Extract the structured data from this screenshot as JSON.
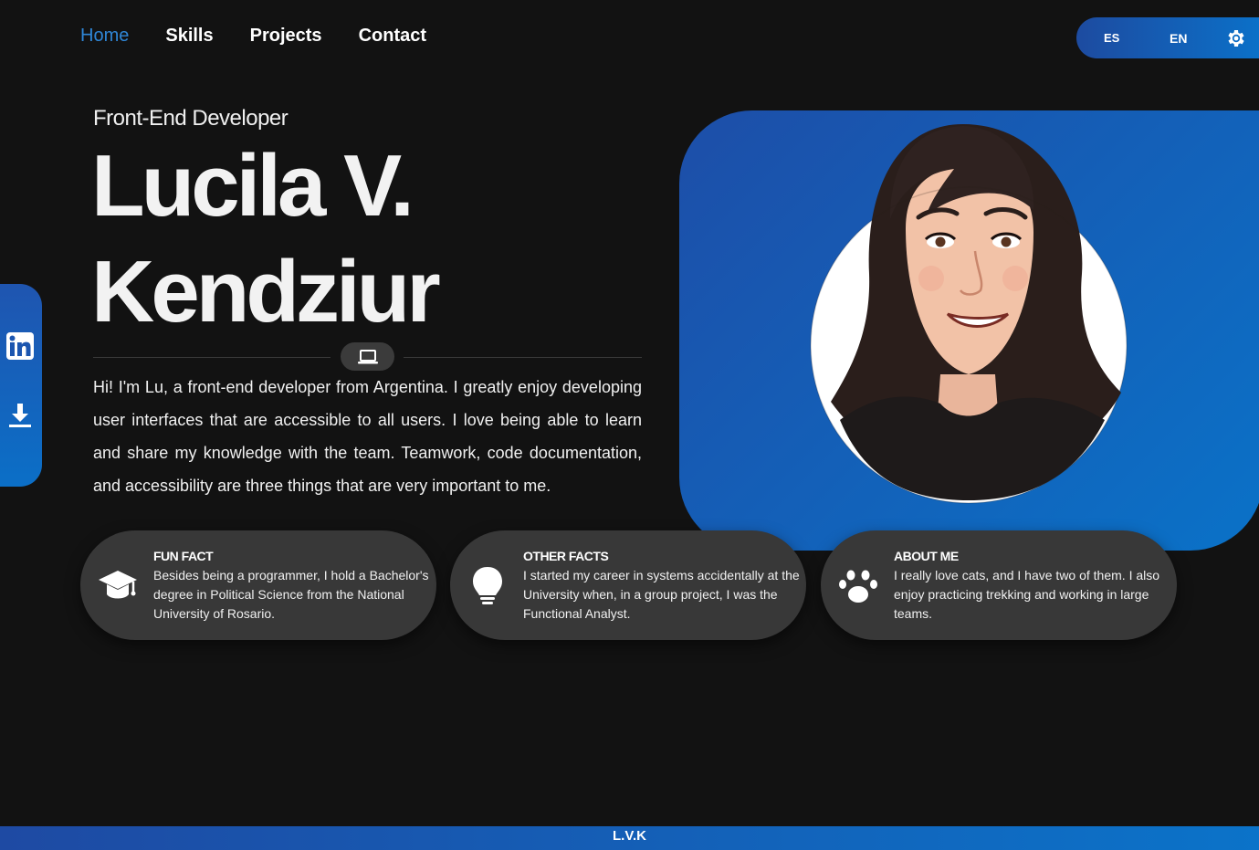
{
  "nav": {
    "items": [
      {
        "label": "Home",
        "active": true
      },
      {
        "label": "Skills",
        "active": false
      },
      {
        "label": "Projects",
        "active": false
      },
      {
        "label": "Contact",
        "active": false
      }
    ]
  },
  "lang": {
    "es": "ES",
    "en": "EN",
    "theme_icon": "gear-icon"
  },
  "side": {
    "icons": [
      "linkedin-icon",
      "download-icon"
    ]
  },
  "hero": {
    "subtitle": "Front-End Developer",
    "name_line1": "Lucila V.",
    "name_line2": "Kendziur",
    "divider_icon": "laptop-icon",
    "bio": "Hi! I'm Lu, a front-end developer from Argentina. I greatly enjoy developing user interfaces that are accessible to all users. I love being able to learn and share my knowledge with the team. Teamwork, code documentation, and accessibility are three things that are very important to me."
  },
  "cards": [
    {
      "icon": "graduation-cap-icon",
      "title": "FUN FACT",
      "text": "Besides being a programmer, I hold a Bachelor's degree in Political Science from the National University of Rosario."
    },
    {
      "icon": "lightbulb-icon",
      "title": "OTHER FACTS",
      "text": "I started my career in systems accidentally at the University when, in a group project, I was the Functional Analyst."
    },
    {
      "icon": "paw-icon",
      "title": "ABOUT ME",
      "text": "I really love cats, and I have two of them. I also enjoy practicing trekking and working in large teams."
    }
  ],
  "footer": {
    "text": "L.V.K"
  },
  "colors": {
    "accent": "#2f86d6",
    "gradient_start": "#1d4ea8",
    "gradient_end": "#0a72c8",
    "background": "#121212",
    "card": "#383838"
  }
}
